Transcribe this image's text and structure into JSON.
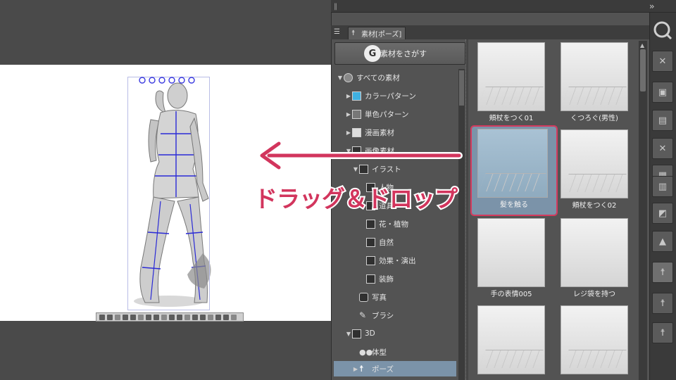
{
  "panel": {
    "tab_label": "素材[ポーズ]",
    "search_button_label": "追加素材をさがす"
  },
  "tree": {
    "items": [
      {
        "label": "すべての素材"
      },
      {
        "label": "カラーパターン"
      },
      {
        "label": "単色パターン"
      },
      {
        "label": "漫画素材"
      },
      {
        "label": "画像素材"
      },
      {
        "label": "イラスト"
      },
      {
        "label": "人物"
      },
      {
        "label": "道具"
      },
      {
        "label": "花・植物"
      },
      {
        "label": "自然"
      },
      {
        "label": "効果・演出"
      },
      {
        "label": "装飾"
      },
      {
        "label": "写真"
      },
      {
        "label": "ブラシ"
      },
      {
        "label": "3D"
      },
      {
        "label": "体型"
      },
      {
        "label": "ポーズ"
      }
    ]
  },
  "materials": [
    {
      "label": "頬杖をつく01"
    },
    {
      "label": "くつろぐ(男性)"
    },
    {
      "label": "髪を触る"
    },
    {
      "label": "頬杖をつく02"
    },
    {
      "label": "手の表情005"
    },
    {
      "label": "レジ袋を持つ"
    },
    {
      "label": ""
    },
    {
      "label": ""
    }
  ],
  "selected_material": "髪を触る",
  "overlay": {
    "caption": "ドラッグ＆ドロップ",
    "accent_color": "#d2355d"
  }
}
